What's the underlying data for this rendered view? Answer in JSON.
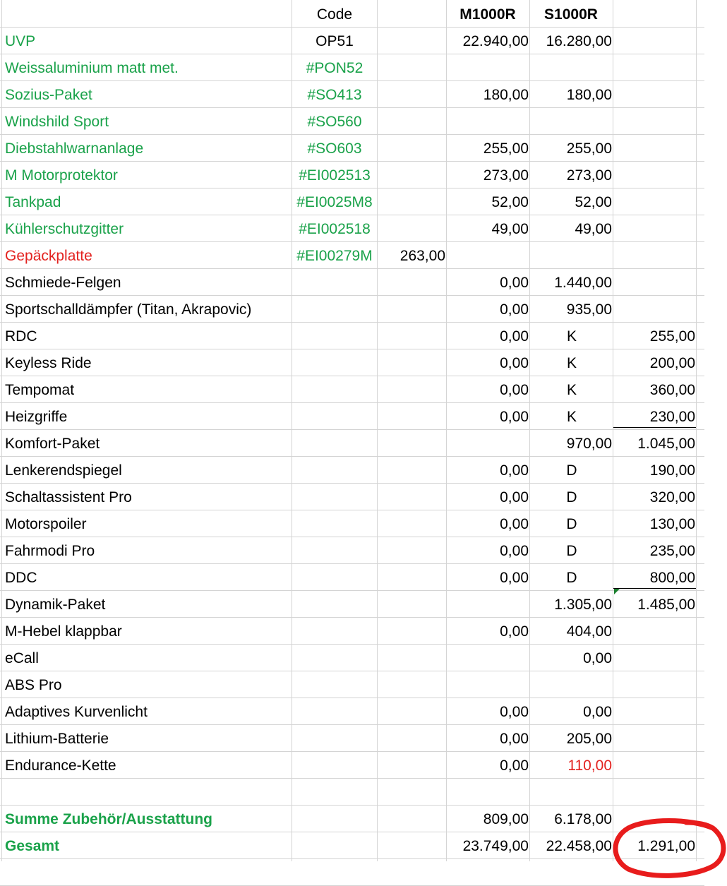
{
  "header": {
    "code": "Code",
    "m": "M1000R",
    "s": "S1000R"
  },
  "rows": [
    {
      "label": "UVP",
      "code": "OP51",
      "x": "",
      "m": "22.940,00",
      "s": "16.280,00",
      "e": "",
      "lc": "green",
      "cc": "",
      "sc": "",
      "scenter": false
    },
    {
      "label": "Weissaluminium matt met.",
      "code": "#PON52",
      "x": "",
      "m": "",
      "s": "",
      "e": "",
      "lc": "green",
      "cc": "green",
      "sc": "",
      "scenter": false
    },
    {
      "label": "Sozius-Paket",
      "code": "#SO413",
      "x": "",
      "m": "180,00",
      "s": "180,00",
      "e": "",
      "lc": "green",
      "cc": "green",
      "sc": "",
      "scenter": false
    },
    {
      "label": "Windshild Sport",
      "code": "#SO560",
      "x": "",
      "m": "",
      "s": "",
      "e": "",
      "lc": "green",
      "cc": "green",
      "sc": "",
      "scenter": false
    },
    {
      "label": "Diebstahlwarnanlage",
      "code": "#SO603",
      "x": "",
      "m": "255,00",
      "s": "255,00",
      "e": "",
      "lc": "green",
      "cc": "green",
      "sc": "",
      "scenter": false
    },
    {
      "label": "M Motorprotektor",
      "code": "#EI002513",
      "x": "",
      "m": "273,00",
      "s": "273,00",
      "e": "",
      "lc": "green",
      "cc": "green",
      "sc": "",
      "scenter": false
    },
    {
      "label": "Tankpad",
      "code": "#EI0025M8",
      "x": "",
      "m": "52,00",
      "s": "52,00",
      "e": "",
      "lc": "green",
      "cc": "green",
      "sc": "",
      "scenter": false
    },
    {
      "label": "Kühlerschutzgitter",
      "code": "#EI002518",
      "x": "",
      "m": "49,00",
      "s": "49,00",
      "e": "",
      "lc": "green",
      "cc": "green",
      "sc": "",
      "scenter": false
    },
    {
      "label": "Gepäckplatte",
      "code": "#EI00279M",
      "x": "263,00",
      "m": "",
      "s": "",
      "e": "",
      "lc": "red",
      "cc": "green",
      "sc": "",
      "scenter": false
    },
    {
      "label": "Schmiede-Felgen",
      "code": "",
      "x": "",
      "m": "0,00",
      "s": "1.440,00",
      "e": "",
      "lc": "",
      "cc": "",
      "sc": "",
      "scenter": false
    },
    {
      "label": "Sportschalldämpfer (Titan, Akrapovic)",
      "code": "",
      "x": "",
      "m": "0,00",
      "s": "935,00",
      "e": "",
      "lc": "",
      "cc": "",
      "sc": "",
      "scenter": false
    },
    {
      "label": "RDC",
      "code": "",
      "x": "",
      "m": "0,00",
      "s": "K",
      "e": "255,00",
      "lc": "",
      "cc": "",
      "sc": "",
      "scenter": true
    },
    {
      "label": "Keyless Ride",
      "code": "",
      "x": "",
      "m": "0,00",
      "s": "K",
      "e": "200,00",
      "lc": "",
      "cc": "",
      "sc": "",
      "scenter": true
    },
    {
      "label": "Tempomat",
      "code": "",
      "x": "",
      "m": "0,00",
      "s": "K",
      "e": "360,00",
      "lc": "",
      "cc": "",
      "sc": "",
      "scenter": true
    },
    {
      "label": "Heizgriffe",
      "code": "",
      "x": "",
      "m": "0,00",
      "s": "K",
      "e": "230,00",
      "lc": "",
      "cc": "",
      "sc": "",
      "scenter": true
    },
    {
      "label": "Komfort-Paket",
      "code": "",
      "x": "",
      "m": "",
      "s": "970,00",
      "e": "1.045,00",
      "lc": "",
      "cc": "",
      "sc": "",
      "scenter": false
    },
    {
      "label": "Lenkerendspiegel",
      "code": "",
      "x": "",
      "m": "0,00",
      "s": "D",
      "e": "190,00",
      "lc": "",
      "cc": "",
      "sc": "",
      "scenter": true
    },
    {
      "label": "Schaltassistent Pro",
      "code": "",
      "x": "",
      "m": "0,00",
      "s": "D",
      "e": "320,00",
      "lc": "",
      "cc": "",
      "sc": "",
      "scenter": true
    },
    {
      "label": "Motorspoiler",
      "code": "",
      "x": "",
      "m": "0,00",
      "s": "D",
      "e": "130,00",
      "lc": "",
      "cc": "",
      "sc": "",
      "scenter": true
    },
    {
      "label": "Fahrmodi Pro",
      "code": "",
      "x": "",
      "m": "0,00",
      "s": "D",
      "e": "235,00",
      "lc": "",
      "cc": "",
      "sc": "",
      "scenter": true
    },
    {
      "label": "DDC",
      "code": "",
      "x": "",
      "m": "0,00",
      "s": "D",
      "e": "800,00",
      "lc": "",
      "cc": "",
      "sc": "",
      "scenter": true
    },
    {
      "label": "Dynamik-Paket",
      "code": "",
      "x": "",
      "m": "",
      "s": "1.305,00",
      "e": "1.485,00",
      "lc": "",
      "cc": "",
      "sc": "",
      "scenter": false
    },
    {
      "label": "M-Hebel klappbar",
      "code": "",
      "x": "",
      "m": "0,00",
      "s": "404,00",
      "e": "",
      "lc": "",
      "cc": "",
      "sc": "",
      "scenter": false
    },
    {
      "label": "eCall",
      "code": "",
      "x": "",
      "m": "",
      "s": "0,00",
      "e": "",
      "lc": "",
      "cc": "",
      "sc": "",
      "scenter": false
    },
    {
      "label": "ABS Pro",
      "code": "",
      "x": "",
      "m": "",
      "s": "",
      "e": "",
      "lc": "",
      "cc": "",
      "sc": "",
      "scenter": false
    },
    {
      "label": "Adaptives Kurvenlicht",
      "code": "",
      "x": "",
      "m": "0,00",
      "s": "0,00",
      "e": "",
      "lc": "",
      "cc": "",
      "sc": "",
      "scenter": false
    },
    {
      "label": "Lithium-Batterie",
      "code": "",
      "x": "",
      "m": "0,00",
      "s": "205,00",
      "e": "",
      "lc": "",
      "cc": "",
      "sc": "",
      "scenter": false
    },
    {
      "label": "Endurance-Kette",
      "code": "",
      "x": "",
      "m": "0,00",
      "s": "110,00",
      "e": "",
      "lc": "",
      "cc": "",
      "sc": "red",
      "scenter": false
    },
    {
      "label": "",
      "code": "",
      "x": "",
      "m": "",
      "s": "",
      "e": "",
      "lc": "",
      "cc": "",
      "sc": "",
      "scenter": false
    },
    {
      "label": "Summe Zubehör/Ausstattung",
      "code": "",
      "x": "",
      "m": "809,00",
      "s": "6.178,00",
      "e": "",
      "lc": "green bold",
      "cc": "",
      "sc": "",
      "scenter": false
    },
    {
      "label": "Gesamt",
      "code": "",
      "x": "",
      "m": "23.749,00",
      "s": "22.458,00",
      "e": "1.291,00",
      "lc": "green bold",
      "cc": "",
      "sc": "",
      "scenter": false
    }
  ],
  "colors": {
    "green_text": "#1aa24a",
    "red_text": "#e3221f",
    "annotation_circle": "#e81c1c",
    "grid": "#d4d4d4"
  }
}
